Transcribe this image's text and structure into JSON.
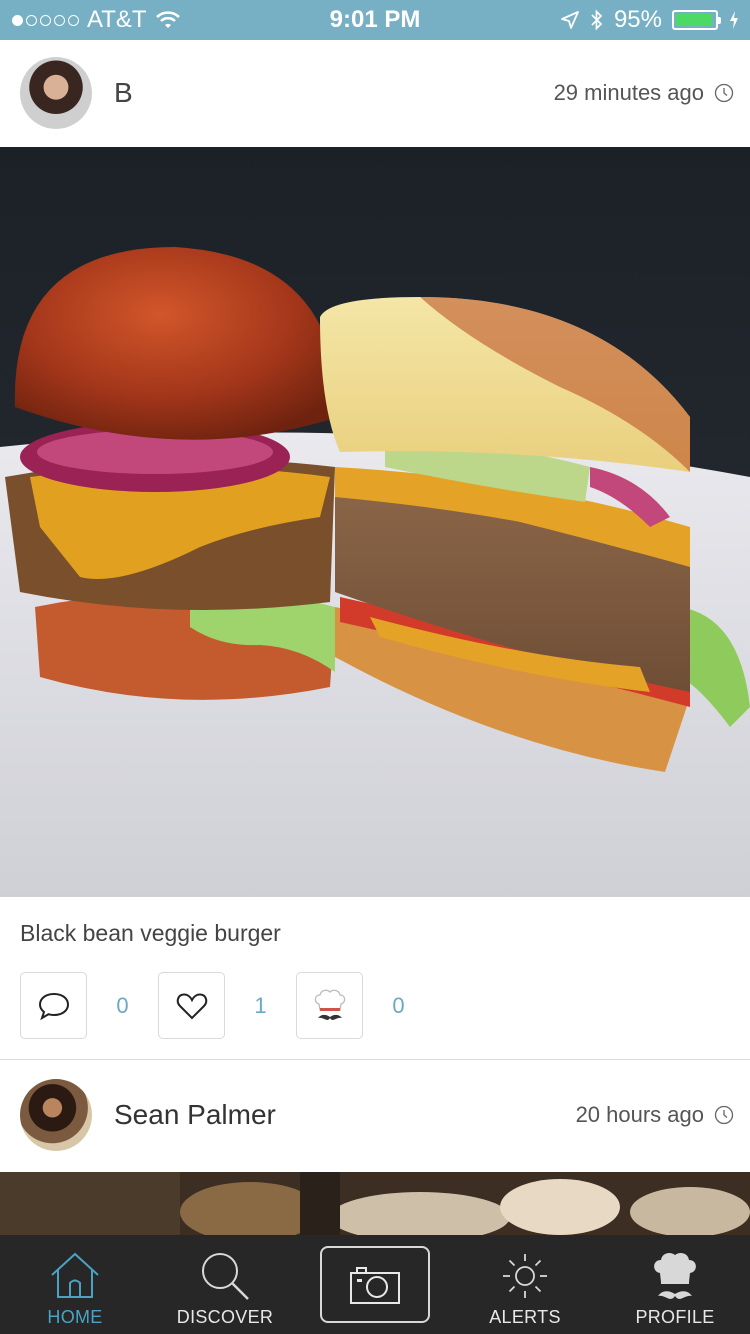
{
  "status_bar": {
    "carrier": "AT&T",
    "time": "9:01 PM",
    "battery": "95%",
    "battery_level": 0.95,
    "signal_bars_filled": 1,
    "signal_bars_total": 5
  },
  "posts": [
    {
      "user": "B",
      "time": "29 minutes ago",
      "image": "Black bean veggie burger photo",
      "caption": "Black bean veggie burger",
      "comments": "0",
      "likes": "1",
      "chef_votes": "0"
    },
    {
      "user": "Sean Palmer",
      "time": "20 hours ago",
      "image": "restaurant table photo"
    }
  ],
  "tabs": [
    {
      "label": "HOME",
      "icon": "home-icon",
      "active": true
    },
    {
      "label": "DISCOVER",
      "icon": "search-icon"
    },
    {
      "label": "",
      "icon": "camera-icon"
    },
    {
      "label": "ALERTS",
      "icon": "sun-icon"
    },
    {
      "label": "PROFILE",
      "icon": "chef-hat-icon"
    }
  ],
  "colors": {
    "status_bar": "#77b0c4",
    "accent": "#4aa3c3",
    "tab_bar": "#272727",
    "count_text": "#6aa9c6"
  }
}
